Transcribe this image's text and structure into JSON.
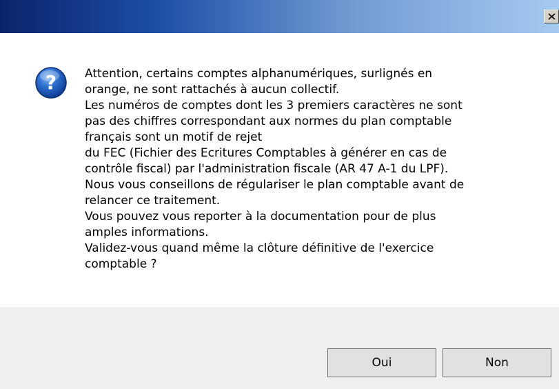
{
  "dialog": {
    "title": "",
    "message_lines": [
      "Attention, certains comptes alphanumériques, surlignés en",
      "orange, ne sont rattachés à aucun collectif.",
      "Les numéros de comptes dont les 3 premiers caractères ne sont",
      "pas des chiffres correspondant aux normes du plan comptable",
      "français sont un motif de rejet",
      "du FEC (Fichier des Ecritures Comptables à générer en cas de",
      "contrôle fiscal) par l'administration fiscale (AR 47 A-1 du LPF).",
      "Nous vous conseillons de régulariser le plan comptable avant de",
      "relancer ce traitement.",
      "Vous pouvez vous reporter à la documentation pour de plus",
      "amples informations.",
      "Validez-vous quand même la clôture définitive de l'exercice",
      "comptable ?"
    ],
    "icon": "question-icon",
    "buttons": {
      "yes_label": "Oui",
      "no_label": "Non"
    }
  },
  "colors": {
    "titlebar_start": "#0a246a",
    "titlebar_end": "#a6caf0",
    "icon_blue": "#1f5fbf",
    "footer_bg": "#f0f0f0",
    "button_bg": "#e1e1e1"
  }
}
